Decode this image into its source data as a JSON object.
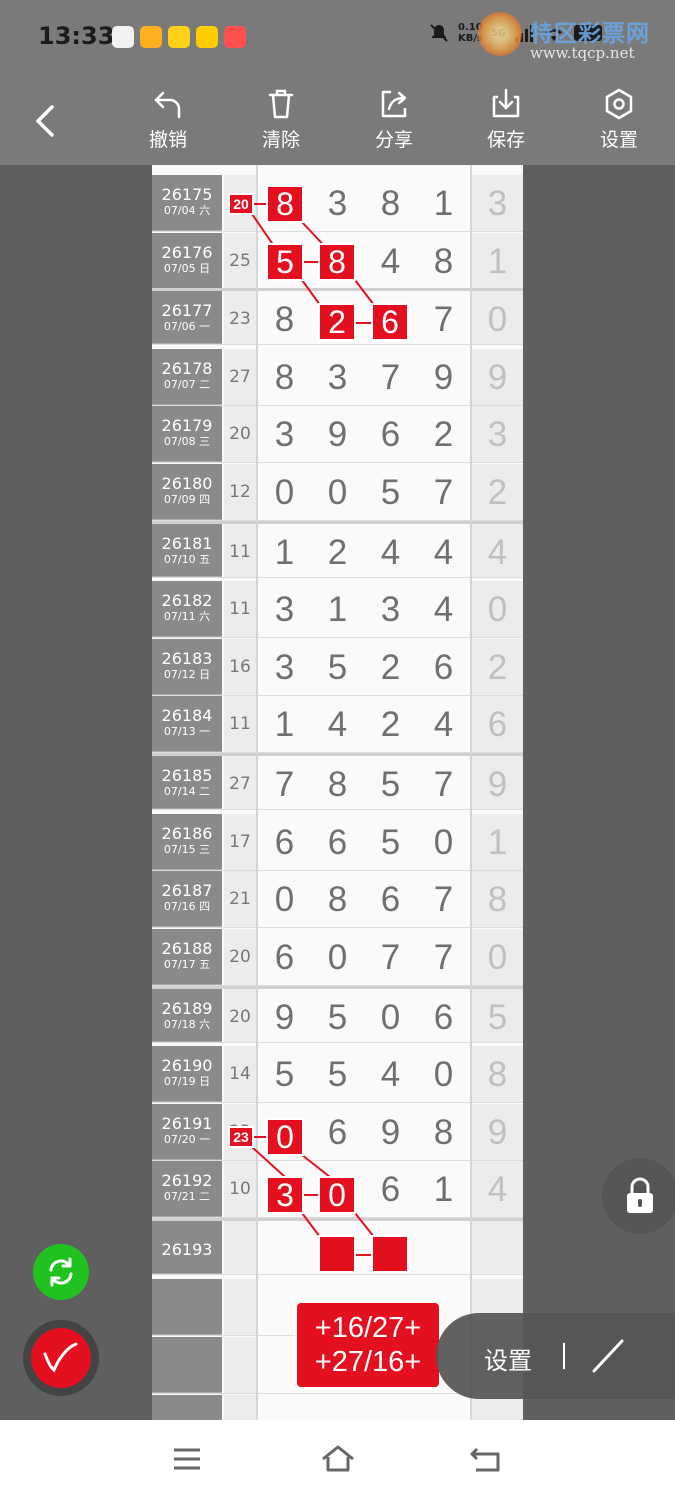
{
  "status_bar": {
    "time": "13:33",
    "network_speed_line1": "0.10",
    "network_speed_line2": "KB/s",
    "signal_label": "5G"
  },
  "watermark": {
    "title": "特区彩票网",
    "url": "www.tqcp.net"
  },
  "toolbar": {
    "undo_label": "撤销",
    "clear_label": "清除",
    "share_label": "分享",
    "save_label": "保存",
    "settings_label": "设置"
  },
  "rows": [
    {
      "issue": "26175",
      "date": "07/04 六",
      "sum": "20",
      "nums": [
        "8",
        "3",
        "8",
        "1"
      ],
      "last": "3"
    },
    {
      "issue": "26176",
      "date": "07/05 日",
      "sum": "25",
      "nums": [
        "5",
        "8",
        "4",
        "8"
      ],
      "last": "1"
    },
    {
      "issue": "26177",
      "date": "07/06 一",
      "sum": "23",
      "nums": [
        "8",
        "2",
        "6",
        "7"
      ],
      "last": "0"
    },
    {
      "issue": "26178",
      "date": "07/07 二",
      "sum": "27",
      "nums": [
        "8",
        "3",
        "7",
        "9"
      ],
      "last": "9"
    },
    {
      "issue": "26179",
      "date": "07/08 三",
      "sum": "20",
      "nums": [
        "3",
        "9",
        "6",
        "2"
      ],
      "last": "3"
    },
    {
      "issue": "26180",
      "date": "07/09 四",
      "sum": "12",
      "nums": [
        "0",
        "0",
        "5",
        "7"
      ],
      "last": "2"
    },
    {
      "issue": "26181",
      "date": "07/10 五",
      "sum": "11",
      "nums": [
        "1",
        "2",
        "4",
        "4"
      ],
      "last": "4"
    },
    {
      "issue": "26182",
      "date": "07/11 六",
      "sum": "11",
      "nums": [
        "3",
        "1",
        "3",
        "4"
      ],
      "last": "0"
    },
    {
      "issue": "26183",
      "date": "07/12 日",
      "sum": "16",
      "nums": [
        "3",
        "5",
        "2",
        "6"
      ],
      "last": "2"
    },
    {
      "issue": "26184",
      "date": "07/13 一",
      "sum": "11",
      "nums": [
        "1",
        "4",
        "2",
        "4"
      ],
      "last": "6"
    },
    {
      "issue": "26185",
      "date": "07/14 二",
      "sum": "27",
      "nums": [
        "7",
        "8",
        "5",
        "7"
      ],
      "last": "9"
    },
    {
      "issue": "26186",
      "date": "07/15 三",
      "sum": "17",
      "nums": [
        "6",
        "6",
        "5",
        "0"
      ],
      "last": "1"
    },
    {
      "issue": "26187",
      "date": "07/16 四",
      "sum": "21",
      "nums": [
        "0",
        "8",
        "6",
        "7"
      ],
      "last": "8"
    },
    {
      "issue": "26188",
      "date": "07/17 五",
      "sum": "20",
      "nums": [
        "6",
        "0",
        "7",
        "7"
      ],
      "last": "0"
    },
    {
      "issue": "26189",
      "date": "07/18 六",
      "sum": "20",
      "nums": [
        "9",
        "5",
        "0",
        "6"
      ],
      "last": "5"
    },
    {
      "issue": "26190",
      "date": "07/19 日",
      "sum": "14",
      "nums": [
        "5",
        "5",
        "4",
        "0"
      ],
      "last": "8"
    },
    {
      "issue": "26191",
      "date": "07/20 一",
      "sum": "23",
      "nums": [
        "0",
        "6",
        "9",
        "8"
      ],
      "last": "9"
    },
    {
      "issue": "26192",
      "date": "07/21 二",
      "sum": "10",
      "nums": [
        "3",
        "0",
        "6",
        "1"
      ],
      "last": "4"
    },
    {
      "issue": "26193",
      "date": "",
      "sum": "",
      "nums": [
        "",
        "",
        "",
        ""
      ],
      "last": ""
    }
  ],
  "expression": {
    "line1": "+16/27+",
    "line2": "+27/16+"
  },
  "settings_pill": {
    "label": "设置"
  },
  "colors": {
    "highlight": "#e4101f",
    "refresh_button": "#1fc21f",
    "toolbar": "#7a7a7a"
  },
  "icons": [
    "back-arrow-icon",
    "undo-icon",
    "trash-icon",
    "share-icon",
    "download-icon",
    "hexagon-settings-icon",
    "lock-icon",
    "refresh-icon",
    "pen-icon",
    "slash-icon",
    "menu-icon",
    "home-icon",
    "back-nav-icon"
  ]
}
